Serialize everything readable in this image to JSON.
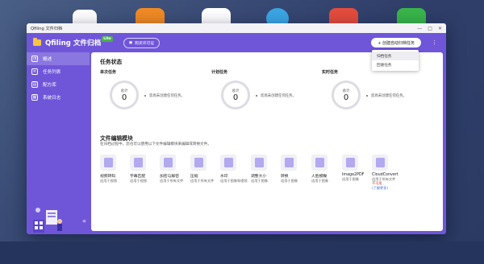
{
  "window": {
    "title": "Qfiling 文件归档",
    "controls": [
      "—",
      "□",
      "✕"
    ]
  },
  "app": {
    "name": "Qfiling 文件归档",
    "badge": "Lite",
    "buy_button": "购买许可证",
    "create_button": "+ 创建自动归档任务",
    "more": "⋮"
  },
  "dropdown": {
    "items": [
      "归档任务",
      "回收任务"
    ]
  },
  "sidebar": {
    "items": [
      {
        "label": "概述",
        "icon": "overview-icon",
        "active": true
      },
      {
        "label": "任务列表",
        "icon": "task-list-icon",
        "active": false
      },
      {
        "label": "配方库",
        "icon": "recipe-icon",
        "active": false
      },
      {
        "label": "系统日志",
        "icon": "log-icon",
        "active": false
      }
    ],
    "collapse": "«"
  },
  "status": {
    "title": "任务状态",
    "cards": [
      {
        "label": "单次任务",
        "total_label": "总计",
        "count": "0",
        "message": "您尚未创建任何任务。"
      },
      {
        "label": "计划任务",
        "total_label": "总计",
        "count": "0",
        "message": "您尚未创建任何任务。"
      },
      {
        "label": "实时任务",
        "total_label": "总计",
        "count": "0",
        "message": "您尚未创建任何任务。"
      }
    ]
  },
  "editor": {
    "title": "文件编辑模块",
    "subtitle": "在归档过程中，您也可以使用以下文件编辑模块来编辑或转换文件。",
    "tools": [
      {
        "name": "视频转码",
        "desc": "适用于视频"
      },
      {
        "name": "字幕匹配",
        "desc": "适用于视频"
      },
      {
        "name": "加密与解密",
        "desc": "适用于所有文件"
      },
      {
        "name": "压缩",
        "desc": "适用于所有文件"
      },
      {
        "name": "水印",
        "desc": "适用于图像和视频"
      },
      {
        "name": "调整大小",
        "desc": "适用于图像"
      },
      {
        "name": "转换",
        "desc": "适用于图像"
      },
      {
        "name": "人脸模糊",
        "desc": "适用于图像"
      },
      {
        "name": "Image2PDF",
        "desc": "适用于图像"
      },
      {
        "name": "CloudConvert",
        "desc": "适用于所有文件",
        "status": "不可用",
        "link": "(了解更多)"
      }
    ]
  },
  "colors": {
    "accent": "#6f56d9",
    "red": "#e02b2b",
    "link": "#3d6fe0",
    "logo": "#f6c445"
  }
}
